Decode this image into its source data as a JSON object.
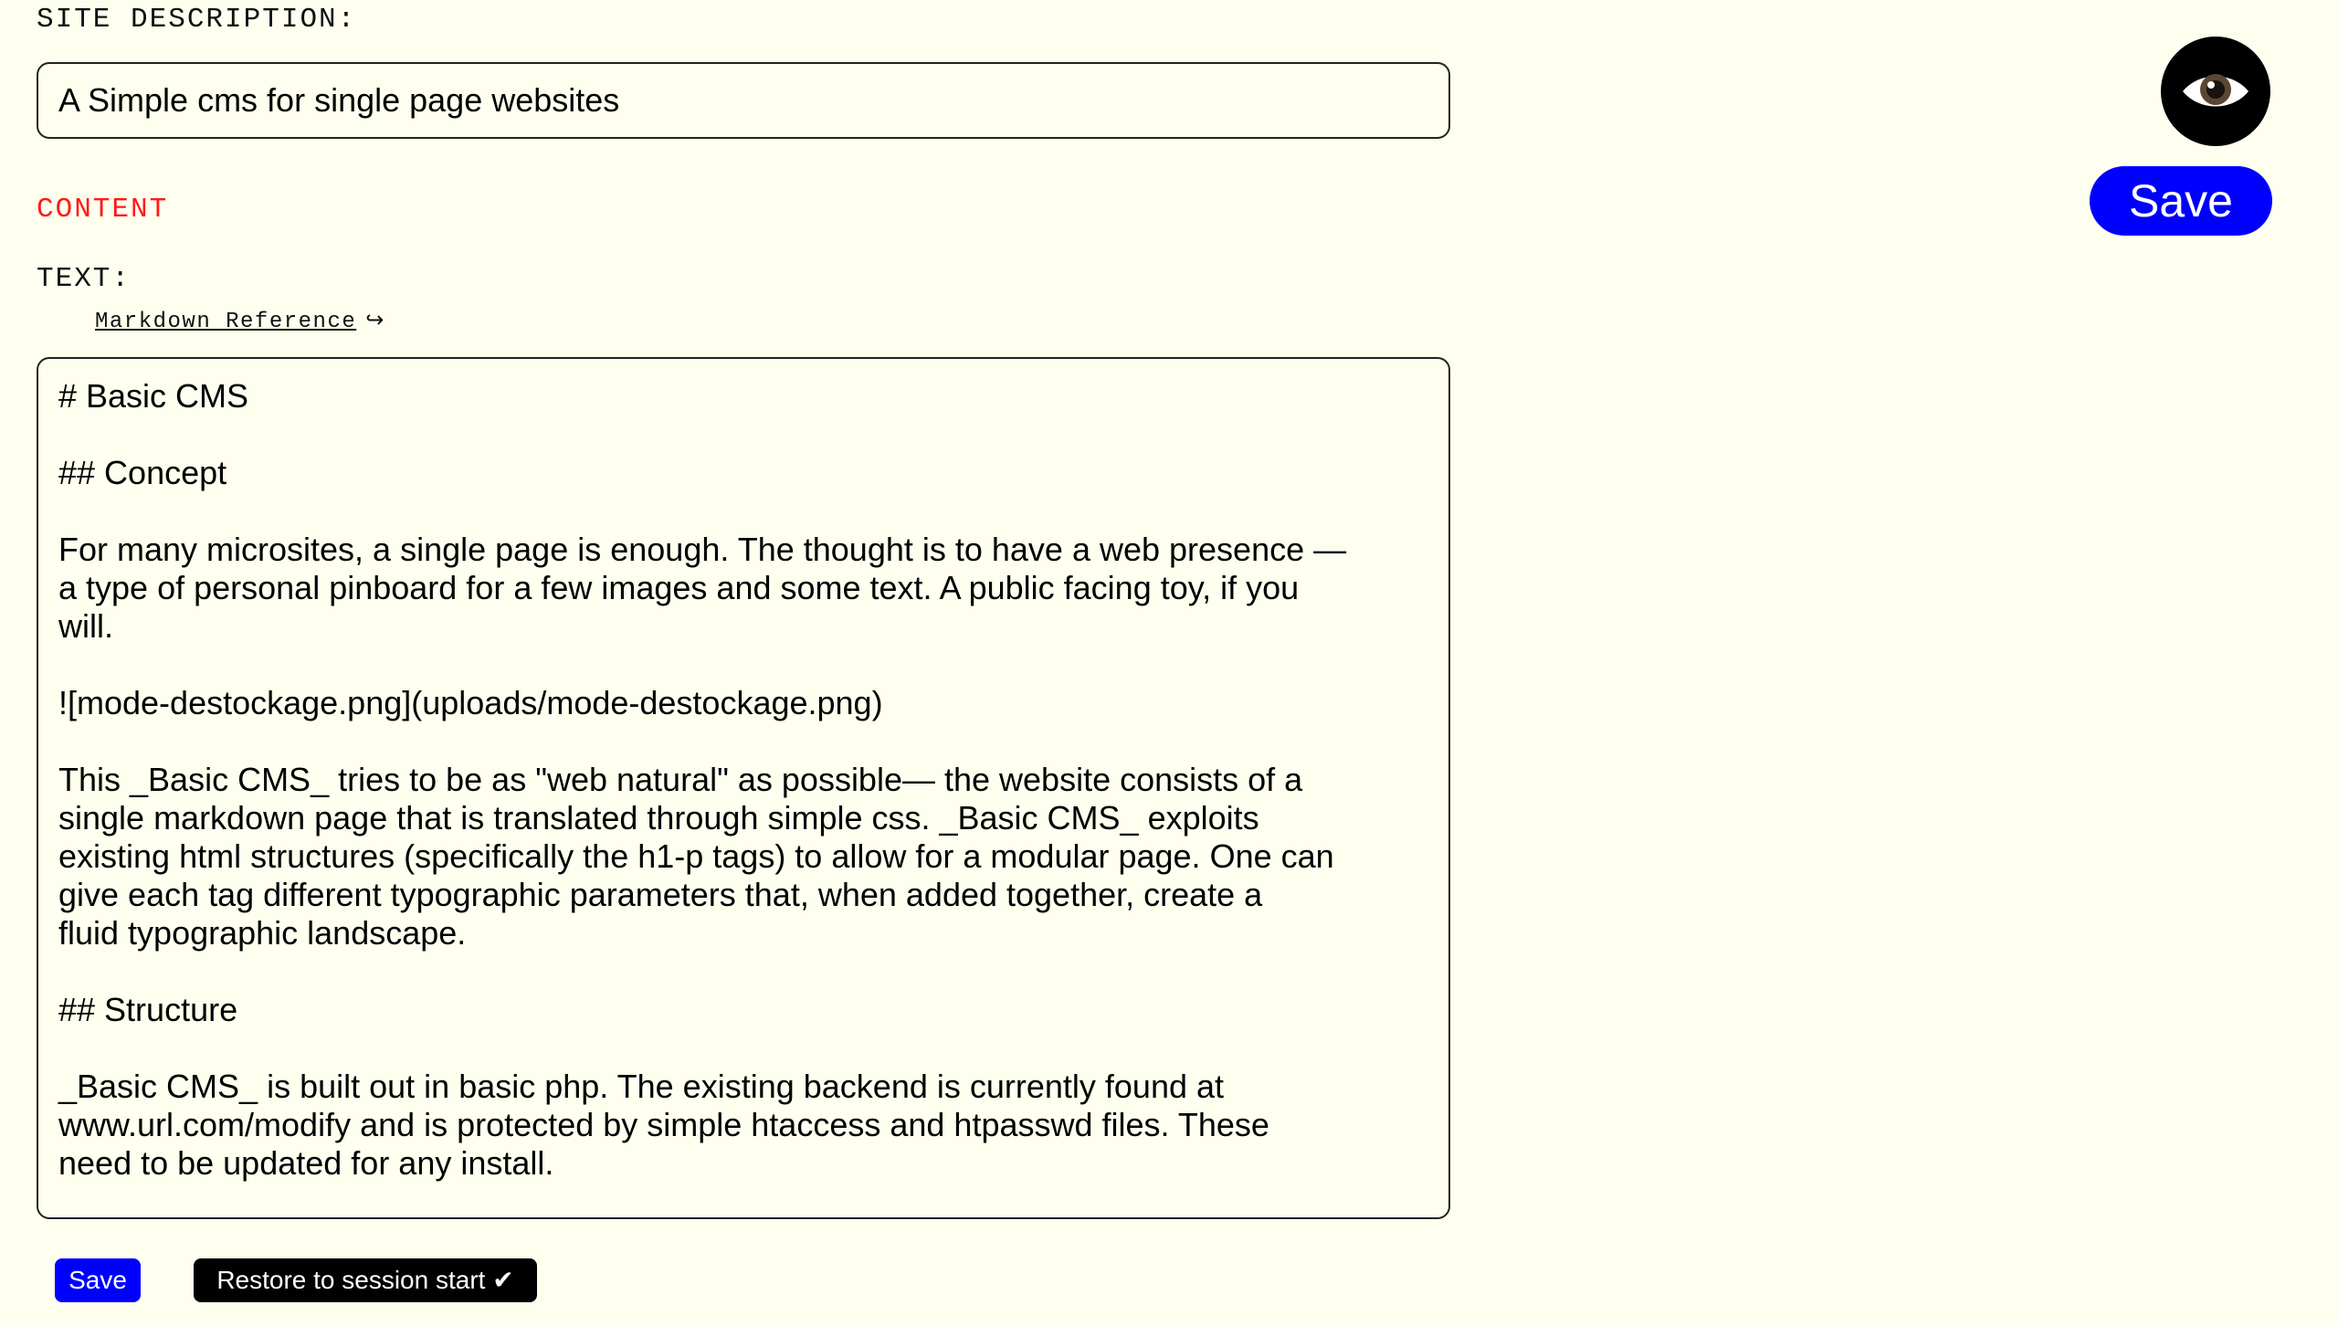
{
  "site_description": {
    "label": "SITE DESCRIPTION:",
    "value": "A Simple cms for single page websites"
  },
  "content_section": {
    "label": "CONTENT"
  },
  "text_field": {
    "label": "TEXT:",
    "markdown_reference_link": "Markdown Reference",
    "markdown_reference_icon": "return-arrow-icon",
    "value": "# Basic CMS\n\n## Concept\n\nFor many microsites, a single page is enough. The thought is to have a web presence —\na type of personal pinboard for a few images and some text. A public facing toy, if you\nwill.\n\n![mode-destockage.png](uploads/mode-destockage.png)\n\nThis _Basic CMS_ tries to be as \"web natural\" as possible— the website consists of a\nsingle markdown page that is translated through simple css. _Basic CMS_ exploits\nexisting html structures (specifically the h1-p tags) to allow for a modular page. One can\ngive each tag different typographic parameters that, when added together, create a\nfluid typographic landscape.\n\n## Structure\n\n_Basic CMS_ is built out in basic php. The existing backend is currently found at\nwww.url.com/modify and is protected by simple htaccess and htpasswd files. These\nneed to be updated for any install."
  },
  "toolbar": {
    "preview_icon": "eye-icon",
    "save_label": "Save"
  },
  "footer_actions": {
    "save_label": "Save",
    "restore_label": "Restore to session start ✔"
  },
  "colors": {
    "background": "#fffff0",
    "accent_blue": "#0000ff",
    "section_red": "#ff1a1a",
    "text": "#000000"
  }
}
